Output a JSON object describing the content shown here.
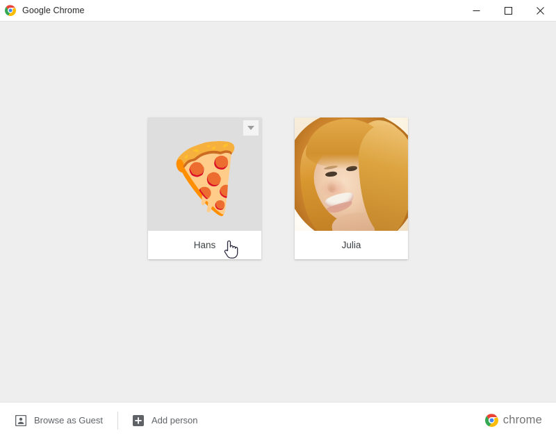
{
  "window": {
    "title": "Google Chrome",
    "app_icon": "chrome-logo-icon",
    "controls": {
      "minimize": "minimize-icon",
      "maximize": "maximize-icon",
      "close": "close-icon"
    }
  },
  "profiles": {
    "cards": [
      {
        "name": "Hans",
        "avatar_type": "pizza-emoji",
        "avatar_glyph": "🍕",
        "has_menu": true,
        "menu_icon": "chevron-down-icon",
        "hovered": true
      },
      {
        "name": "Julia",
        "avatar_type": "photo",
        "avatar_glyph": "",
        "has_menu": false,
        "menu_icon": "",
        "hovered": false
      }
    ]
  },
  "bottom_bar": {
    "browse_as_guest": {
      "label": "Browse as Guest",
      "icon": "person-icon"
    },
    "add_person": {
      "label": "Add person",
      "icon": "plus-square-icon"
    },
    "brand": {
      "text": "chrome",
      "icon": "chrome-logo-icon"
    }
  },
  "cursor": {
    "type": "pointing-hand-cursor"
  },
  "colors": {
    "page_background": "#eeeeee",
    "card_background": "#ffffff",
    "avatar_placeholder": "#dedede",
    "title_text": "#262626",
    "name_text": "#3c4043",
    "action_text": "#5f6368",
    "brand_text": "#737373",
    "chrome_red": "#ea4335",
    "chrome_yellow": "#fbbc05",
    "chrome_green": "#34a853",
    "chrome_blue": "#4285f4"
  }
}
